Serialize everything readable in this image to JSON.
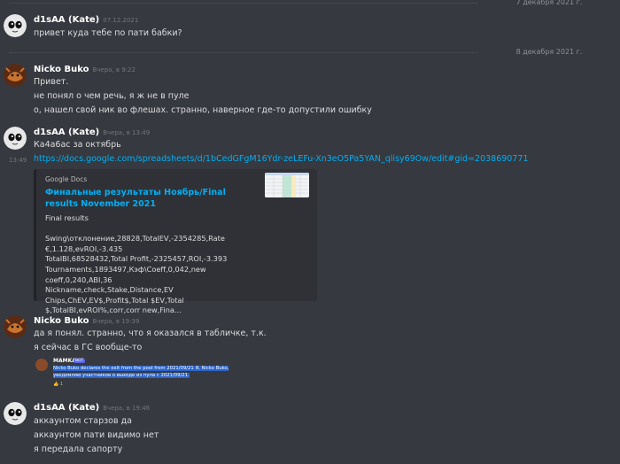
{
  "dividers": {
    "first": "7 декабря 2021 г.",
    "second": "8 декабря 2021 г."
  },
  "messages": [
    {
      "author": "d1sAA (Kate)",
      "timestamp": "07.12.2021",
      "lines": [
        "привет куда тебе по пати бабки?"
      ]
    },
    {
      "author": "Nicko Buko",
      "timestamp": "Вчера, в 9:22",
      "lines": [
        "Привет.",
        "не понял о чем речь, я ж не в пуле",
        "о, нашел свой ник во флешах. странно, наверное где-то допустили ошибку"
      ]
    },
    {
      "author": "d1sAA (Kate)",
      "timestamp": "Вчера, в 13:49",
      "lines": [
        "Ка4а6ас за октябрь"
      ],
      "hover_time": "13:49",
      "link": "https://docs.google.com/spreadsheets/d/1bCedGFgM16Ydr-zeLEFu-Xn3eO5Pa5YAN_qlisy69Ow/edit#gid=2038690771",
      "embed": {
        "provider": "Google Docs",
        "title": "Финальные результаты Ноябрь/Final results November 2021",
        "description": "Final results\n\nSwing\\отклонение,28828,TotalEV,-2354285,Rate €,1.128,evROI,-3.435\nTotalBI,68528432,Total Profit,-2325457,ROI,-3.393\nTournaments,1893497,Кэф\\Coeff,0,042,new coeff,0,240,ABI,36\nNickname,check,Stake,Distance,EV Chips,ChEV,EV$,Profit$,Total $EV,Total $,TotalBI,evROI%,corr,corr new,Fina..."
      }
    },
    {
      "author": "Nicko Buko",
      "timestamp": "Вчера, в 19:39",
      "lines": [
        "да я понял. странно, что я оказался в табличке, т.к.",
        "я сейчас в ГС вообще-то"
      ],
      "quoted": {
        "author": "MAMKA",
        "badge": "BOT",
        "text": "Nicko Buko declares the exit from the pool from 2021/09/21 Я, Nicko Buko, уведомляю участников о выходе из пула с 2021/09/21.",
        "reaction": "1"
      }
    },
    {
      "author": "d1sAA (Kate)",
      "timestamp": "Вчера, в 19:46",
      "lines": [
        "аккаунтом старзов да",
        "аккаунтом пати видимо нет",
        "я передала сапорту"
      ]
    }
  ],
  "colors": {
    "background": "#36393f",
    "link": "#00aff4",
    "embed_background": "#2f3136",
    "highlight": "#2b63c9"
  }
}
